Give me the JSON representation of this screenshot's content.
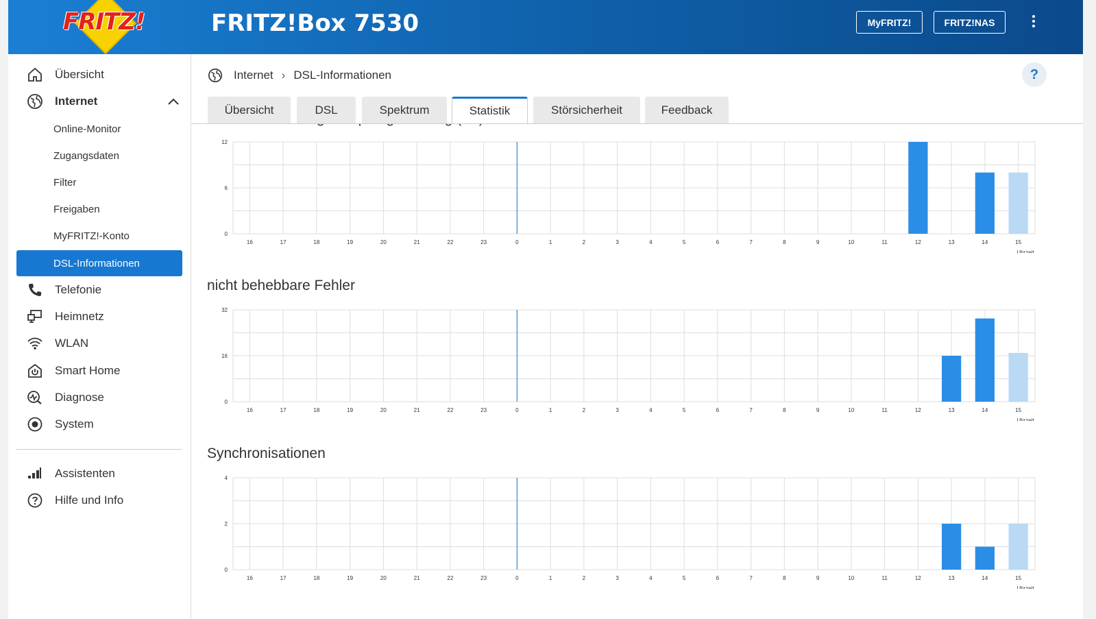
{
  "header": {
    "logo_text": "FRITZ!",
    "product": "FRITZ!Box 7530",
    "buttons": [
      "MyFRITZ!",
      "FRITZ!NAS"
    ]
  },
  "sidebar": {
    "items": [
      {
        "label": "Übersicht",
        "icon": "home-icon"
      },
      {
        "label": "Internet",
        "icon": "globe-icon"
      },
      {
        "label": "Telefonie",
        "icon": "phone-icon"
      },
      {
        "label": "Heimnetz",
        "icon": "network-icon"
      },
      {
        "label": "WLAN",
        "icon": "wifi-icon"
      },
      {
        "label": "Smart Home",
        "icon": "power-icon"
      },
      {
        "label": "Diagnose",
        "icon": "diagnose-icon"
      },
      {
        "label": "System",
        "icon": "system-icon"
      }
    ],
    "internet_sub": [
      "Online-Monitor",
      "Zugangsdaten",
      "Filter",
      "Freigaben",
      "MyFRITZ!-Konto",
      "DSL-Informationen"
    ],
    "active_sub": "DSL-Informationen",
    "bottom": [
      {
        "label": "Assistenten",
        "icon": "assistant-icon"
      },
      {
        "label": "Hilfe und Info",
        "icon": "help-circle-icon"
      }
    ]
  },
  "breadcrumb": {
    "root": "Internet",
    "current": "DSL-Informationen"
  },
  "help_label": "?",
  "tabs": [
    "Übersicht",
    "DSL",
    "Spektrum",
    "Statistik",
    "Störsicherheit",
    "Feedback"
  ],
  "active_tab": "Statistik",
  "partial_section_title": "Störabstandsmarge Empfangsrichtung (dB)",
  "colors": {
    "bar": "#2b8ee6",
    "bar_current": "#b9d9f5",
    "marker": "#5a9bd5",
    "grid": "#dddddd"
  },
  "chart_data": [
    {
      "type": "bar",
      "title": "",
      "categories": [
        "16",
        "17",
        "18",
        "19",
        "20",
        "21",
        "22",
        "23",
        "0",
        "1",
        "2",
        "3",
        "4",
        "5",
        "6",
        "7",
        "8",
        "9",
        "10",
        "11",
        "12",
        "13",
        "14",
        "15"
      ],
      "values": [
        0,
        0,
        0,
        0,
        0,
        0,
        0,
        0,
        0,
        0,
        0,
        0,
        0,
        0,
        0,
        0,
        0,
        0,
        0,
        0,
        12,
        0,
        8,
        8
      ],
      "current_index": 23,
      "ylim": [
        0,
        12
      ],
      "yticks": [
        "0",
        "6",
        "12"
      ],
      "xlabel": "Uhrzeit",
      "marker_at": "0"
    },
    {
      "type": "bar",
      "title": "nicht behebbare Fehler",
      "categories": [
        "16",
        "17",
        "18",
        "19",
        "20",
        "21",
        "22",
        "23",
        "0",
        "1",
        "2",
        "3",
        "4",
        "5",
        "6",
        "7",
        "8",
        "9",
        "10",
        "11",
        "12",
        "13",
        "14",
        "15"
      ],
      "values": [
        0,
        0,
        0,
        0,
        0,
        0,
        0,
        0,
        0,
        0,
        0,
        0,
        0,
        0,
        0,
        0,
        0,
        0,
        0,
        0,
        0,
        16,
        29,
        17
      ],
      "current_index": 23,
      "ylim": [
        0,
        32
      ],
      "yticks": [
        "0",
        "16",
        "32"
      ],
      "xlabel": "Uhrzeit",
      "marker_at": "0"
    },
    {
      "type": "bar",
      "title": "Synchronisationen",
      "categories": [
        "16",
        "17",
        "18",
        "19",
        "20",
        "21",
        "22",
        "23",
        "0",
        "1",
        "2",
        "3",
        "4",
        "5",
        "6",
        "7",
        "8",
        "9",
        "10",
        "11",
        "12",
        "13",
        "14",
        "15"
      ],
      "values": [
        0,
        0,
        0,
        0,
        0,
        0,
        0,
        0,
        0,
        0,
        0,
        0,
        0,
        0,
        0,
        0,
        0,
        0,
        0,
        0,
        0,
        2,
        1,
        2
      ],
      "current_index": 23,
      "ylim": [
        0,
        4
      ],
      "yticks": [
        "0",
        "2",
        "4"
      ],
      "xlabel": "Uhrzeit",
      "marker_at": "0"
    }
  ]
}
